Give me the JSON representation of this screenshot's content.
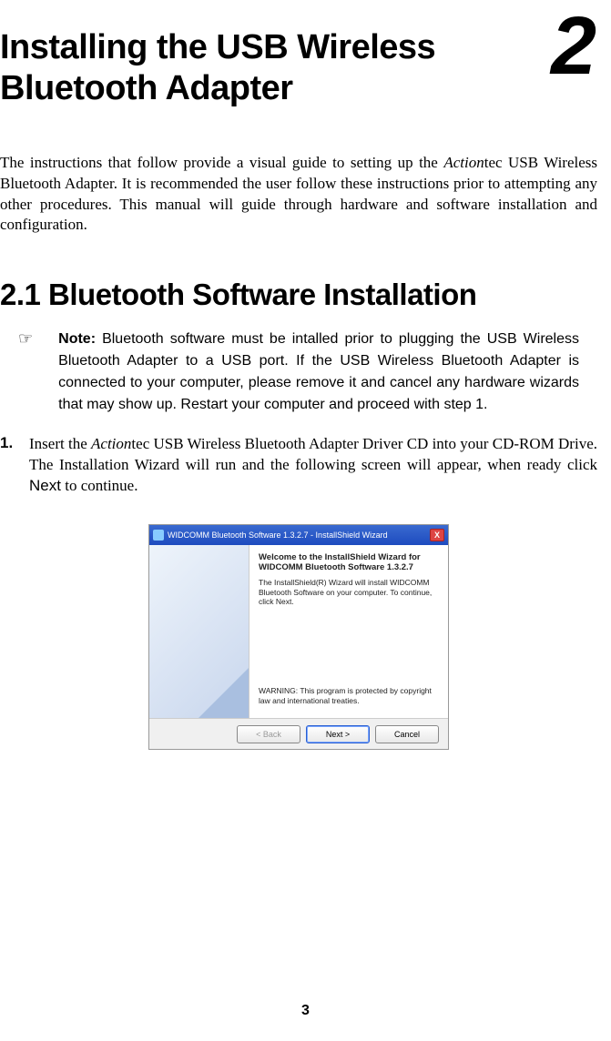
{
  "chapter": {
    "number": "2",
    "title": "Installing the USB Wireless Bluetooth Adapter"
  },
  "intro": {
    "pre": "The instructions that follow provide a visual guide to setting up the ",
    "brand_italic": "Action",
    "brand_rest": "tec USB Wireless Bluetooth Adapter. It is recommended the user follow these instructions prior to attempting any other procedures. This manual will guide through  hardware and software installation and configuration."
  },
  "section": {
    "number": "2.1",
    "title": "Bluetooth Software Installation"
  },
  "note": {
    "icon": "☞",
    "label": "Note:",
    "text": "  Bluetooth software must be intalled prior to plugging the USB Wireless Bluetooth Adapter to a USB port. If the USB  Wireless Bluetooth Adapter is connected to your computer, please remove it and cancel any hardware wizards that may show up. Restart your computer and proceed with step 1."
  },
  "steps": [
    {
      "num": "1.",
      "pre": "Insert the ",
      "brand_italic": "Action",
      "mid": "tec USB Wireless Bluetooth Adapter Driver CD into your CD-ROM Drive. The Installation Wizard will run and the following screen will appear, when ready click ",
      "bold": "Next",
      "post": " to continue."
    }
  ],
  "screenshot": {
    "title": "WIDCOMM Bluetooth Software 1.3.2.7 - InstallShield Wizard",
    "close": "X",
    "heading": "Welcome to the InstallShield Wizard for WIDCOMM Bluetooth Software 1.3.2.7",
    "para1": "The InstallShield(R) Wizard will install WIDCOMM Bluetooth Software on your computer. To continue, click Next.",
    "para2": "WARNING: This program is protected by copyright law and international treaties.",
    "buttons": {
      "back": "< Back",
      "next": "Next >",
      "cancel": "Cancel"
    }
  },
  "page_number": "3"
}
